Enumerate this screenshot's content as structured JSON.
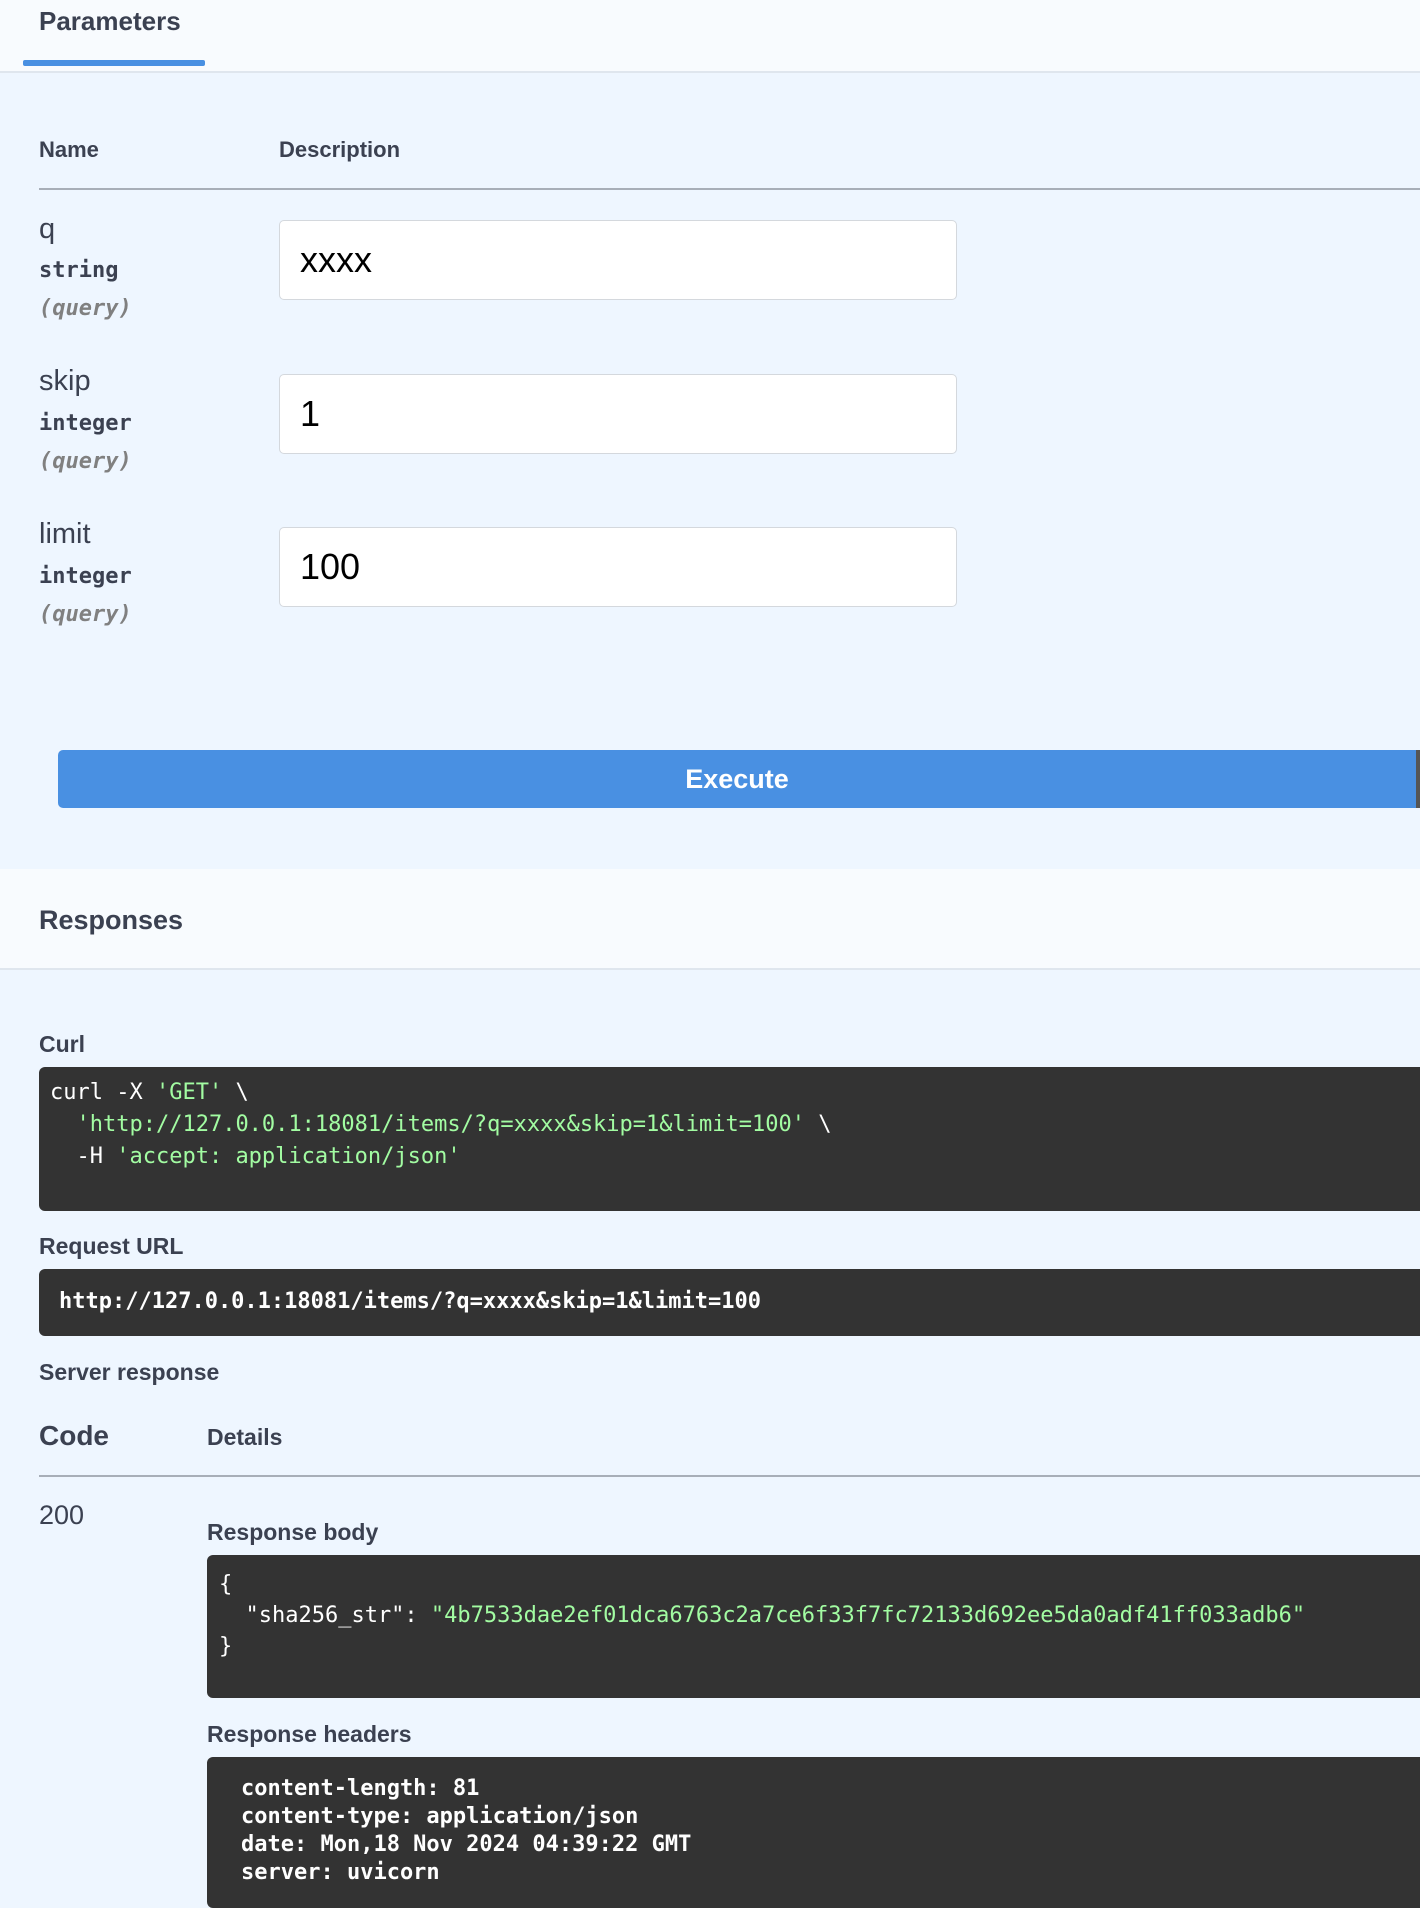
{
  "tabs": {
    "parameters": "Parameters"
  },
  "params": {
    "header_name": "Name",
    "header_description": "Description",
    "items": [
      {
        "name": "q",
        "type": "string",
        "in": "(query)",
        "value": "xxxx"
      },
      {
        "name": "skip",
        "type": "integer",
        "in": "(query)",
        "value": "1"
      },
      {
        "name": "limit",
        "type": "integer",
        "in": "(query)",
        "value": "100"
      }
    ]
  },
  "execute_label": "Execute",
  "responses": {
    "title": "Responses",
    "curl_label": "Curl",
    "curl": {
      "l1a": "curl -X ",
      "l1b": "'GET'",
      "l1c": " \\",
      "l2a": "  ",
      "l2b": "'http://127.0.0.1:18081/items/?q=xxxx&skip=1&limit=100'",
      "l2c": " \\",
      "l3a": "  -H ",
      "l3b": "'accept: application/json'"
    },
    "request_url_label": "Request URL",
    "request_url": "http://127.0.0.1:18081/items/?q=xxxx&skip=1&limit=100",
    "server_response_label": "Server response",
    "code_header": "Code",
    "details_header": "Details",
    "code": "200",
    "body_label": "Response body",
    "body": {
      "open": "{",
      "key": "  \"sha256_str\": ",
      "value": "\"4b7533dae2ef01dca6763c2a7ce6f33f7fc72133d692ee5da0adf41ff033adb6\"",
      "close": "}"
    },
    "headers_label": "Response headers",
    "headers": [
      "content-length: 81",
      "content-type: application/json",
      "date: Mon,18 Nov 2024 04:39:22 GMT",
      "server: uvicorn"
    ]
  }
}
